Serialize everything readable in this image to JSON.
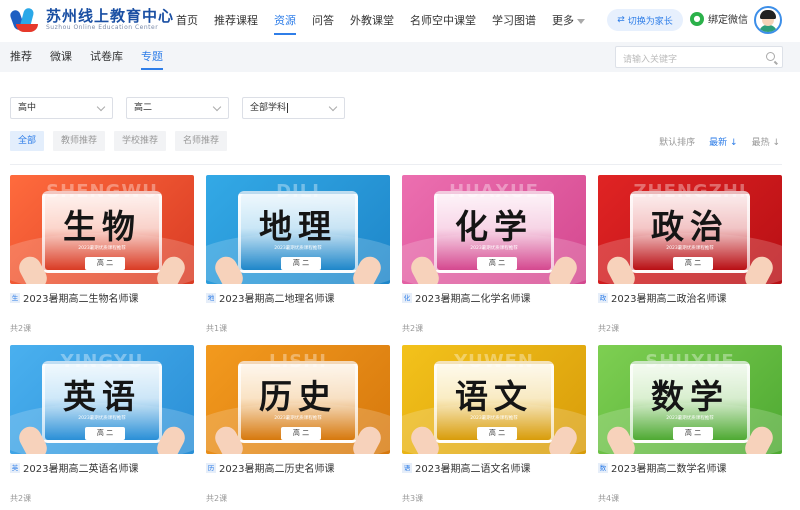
{
  "header": {
    "logo_cn": "苏州线上教育中心",
    "logo_en": "Suzhou Online Education Center",
    "nav": [
      "首页",
      "推荐课程",
      "资源",
      "问答",
      "外教课堂",
      "名师空中课堂",
      "学习图谱",
      "更多"
    ],
    "active_nav": "资源",
    "switch_parent": "切换为家长",
    "bind_wechat": "绑定微信"
  },
  "subnav": {
    "tabs": [
      "推荐",
      "微课",
      "试卷库",
      "专题"
    ],
    "active": "专题",
    "search_placeholder": "请输入关键字"
  },
  "filters": {
    "stage": "高中",
    "grade": "高二",
    "subject": "全部学科"
  },
  "chips": [
    "全部",
    "教师推荐",
    "学校推荐",
    "名师推荐"
  ],
  "active_chip": "全部",
  "sorts": [
    "默认排序",
    "最新",
    "最热"
  ],
  "active_sort": "最新",
  "cards": [
    {
      "subject": "生物",
      "bg": "SHENGWU",
      "tag": "生",
      "title": "2023暑期高二生物名师课",
      "count": "共2课",
      "grade": "高 二",
      "sub": "2023暑期优质课程推荐",
      "color": "#ff6b3d",
      "color2": "#d93b24"
    },
    {
      "subject": "地理",
      "bg": "DILI",
      "tag": "地",
      "title": "2023暑期高二地理名师课",
      "count": "共1课",
      "grade": "高 二",
      "sub": "2023暑期优质课程推荐",
      "color": "#33a9e6",
      "color2": "#1e86c9"
    },
    {
      "subject": "化学",
      "bg": "HUAXUE",
      "tag": "化",
      "title": "2023暑期高二化学名师课",
      "count": "共2课",
      "grade": "高 二",
      "sub": "2023暑期优质课程推荐",
      "color": "#ec6fb0",
      "color2": "#d4488f"
    },
    {
      "subject": "政治",
      "bg": "ZHENGZHI",
      "tag": "政",
      "title": "2023暑期高二政治名师课",
      "count": "共2课",
      "grade": "高 二",
      "sub": "2023暑期优质课程推荐",
      "color": "#e02424",
      "color2": "#b80f14"
    },
    {
      "subject": "英语",
      "bg": "YINGYU",
      "tag": "英",
      "title": "2023暑期高二英语名师课",
      "count": "共2课",
      "grade": "高 二",
      "sub": "2023暑期优质课程推荐",
      "color": "#4ab0ef",
      "color2": "#2a8fd6"
    },
    {
      "subject": "历史",
      "bg": "LISHI",
      "tag": "历",
      "title": "2023暑期高二历史名师课",
      "count": "共2课",
      "grade": "高 二",
      "sub": "2023暑期优质课程推荐",
      "color": "#f39a1e",
      "color2": "#d6780d"
    },
    {
      "subject": "语文",
      "bg": "YUWEN",
      "tag": "语",
      "title": "2023暑期高二语文名师课",
      "count": "共3课",
      "grade": "高 二",
      "sub": "2023暑期优质课程推荐",
      "color": "#f3c21b",
      "color2": "#d89c0a"
    },
    {
      "subject": "数学",
      "bg": "SHUXUE",
      "tag": "数",
      "title": "2023暑期高二数学名师课",
      "count": "共4课",
      "grade": "高 二",
      "sub": "2023暑期优质课程推荐",
      "color": "#7ecf52",
      "color2": "#4ea932"
    }
  ]
}
